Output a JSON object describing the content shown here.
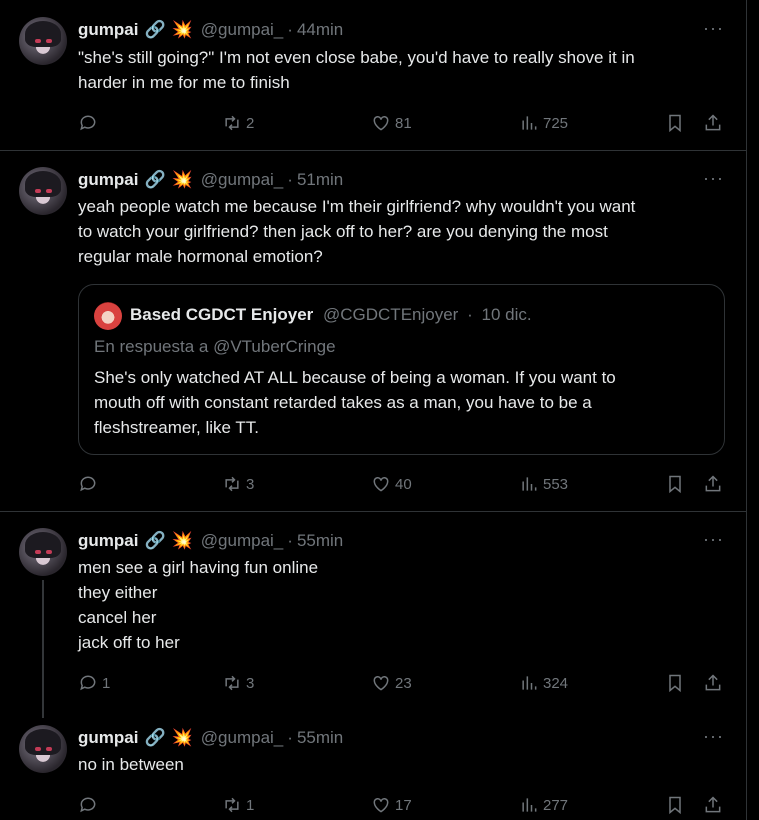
{
  "tweets": [
    {
      "name": "gumpai",
      "handle": "@gumpai_",
      "time": "44min",
      "text_lines": [
        "\"she's still going?\" I'm not even close babe, you'd have to really shove it in",
        "harder in me for me to finish"
      ],
      "replies": "",
      "retweets": "2",
      "likes": "81",
      "views": "725"
    },
    {
      "name": "gumpai",
      "handle": "@gumpai_",
      "time": "51min",
      "text_lines": [
        "yeah people watch me because I'm their girlfriend? why wouldn't you want",
        "to watch your girlfriend? then jack off to her? are you denying the most",
        "regular male hormonal emotion?"
      ],
      "quote": {
        "name": "Based CGDCT Enjoyer",
        "handle": "@CGDCTEnjoyer",
        "time": "10 dic.",
        "reply_to": "En respuesta a @VTuberCringe",
        "text_lines": [
          "She's only watched AT ALL because of being a woman. If you want to",
          "mouth off with constant retarded takes as a man, you have to be a",
          "fleshstreamer, like TT."
        ]
      },
      "replies": "",
      "retweets": "3",
      "likes": "40",
      "views": "553"
    },
    {
      "name": "gumpai",
      "handle": "@gumpai_",
      "time": "55min",
      "text_lines": [
        "men see a girl having fun online",
        "they either",
        "cancel her",
        "jack off to her"
      ],
      "replies": "1",
      "retweets": "3",
      "likes": "23",
      "views": "324"
    },
    {
      "name": "gumpai",
      "handle": "@gumpai_",
      "time": "55min",
      "text_lines": [
        "no in between"
      ],
      "replies": "",
      "retweets": "1",
      "likes": "17",
      "views": "277"
    }
  ],
  "ui": {
    "dot": "·",
    "more": "···",
    "emoji_link": "🔗",
    "emoji_boom": "💥"
  },
  "colors": {
    "background": "#000000",
    "text": "#e7e9ea",
    "muted": "#71767b",
    "border": "#2f3336"
  }
}
